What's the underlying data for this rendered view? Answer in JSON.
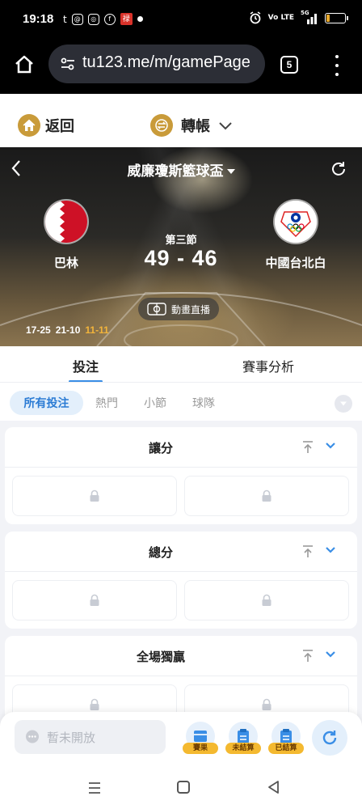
{
  "status_bar": {
    "time": "19:18",
    "icons": [
      "tumblr-icon",
      "threads-icon",
      "instagram-icon",
      "facebook-icon",
      "app-icon",
      "dot-icon"
    ],
    "volte": "Vo LTE",
    "network": "5G",
    "battery_level": 0.2
  },
  "browser": {
    "url": "tu123.me/m/gamePage",
    "tab_count": "5"
  },
  "nav": {
    "back_label": "返回",
    "transfer_label": "轉帳"
  },
  "match": {
    "league": "威廉瓊斯籃球盃",
    "home_team": "巴林",
    "away_team": "中國台北白",
    "period": "第三節",
    "score": "49 - 46",
    "animation_label": "動畫直播",
    "quarter_scores": [
      "17-25",
      "21-10"
    ],
    "current_quarter_score": "11-11"
  },
  "tabs": {
    "bet": "投注",
    "analysis": "賽事分析"
  },
  "filters": [
    "所有投注",
    "熱門",
    "小節",
    "球隊"
  ],
  "markets": [
    {
      "title": "讓分"
    },
    {
      "title": "總分"
    },
    {
      "title": "全場獨贏"
    }
  ],
  "bottom": {
    "bet_placeholder": "暫未開放",
    "buttons": [
      "賽果",
      "未結算",
      "已結算"
    ]
  },
  "colors": {
    "accent_blue": "#3a8ee6",
    "gold": "#c99b3a",
    "current_quarter": "#f2b43b",
    "bahrain_red": "#ce1126"
  }
}
